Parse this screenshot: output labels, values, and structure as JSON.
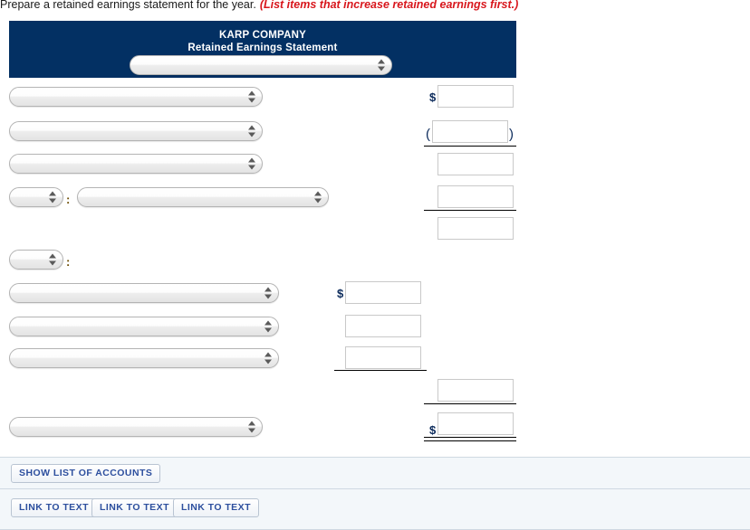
{
  "prompt": {
    "text": "Prepare a retained earnings statement for the year.",
    "hint": "(List items that increase retained earnings first.)"
  },
  "statement": {
    "company": "KARP COMPANY",
    "title": "Retained Earnings Statement",
    "period_select": {
      "value": "",
      "name": "statement-period-select"
    }
  },
  "colors": {
    "header_navy": "#033063",
    "hint_red": "#d8161c",
    "button_blue": "#2d4f9e",
    "footer_bg": "#f3f7fa"
  },
  "rows": [
    {
      "id": "row-1",
      "label_select": "",
      "amount": "",
      "prefix": "$",
      "suffix": ""
    },
    {
      "id": "row-2",
      "label_select": "",
      "amount": "",
      "prefix": "(",
      "suffix": ")"
    },
    {
      "id": "row-3",
      "label_select": "",
      "amount": "",
      "prefix": "",
      "suffix": ""
    },
    {
      "id": "row-4",
      "label_select_small": "",
      "label_select": "",
      "separator": ":",
      "amount": "",
      "prefix": "",
      "suffix": ""
    },
    {
      "id": "row-5-subtotal",
      "amount": "",
      "prefix": "",
      "suffix": ""
    },
    {
      "id": "row-6-heading",
      "label_select_small": "",
      "separator": ":"
    },
    {
      "id": "row-7",
      "label_select": "",
      "amount": "",
      "prefix": "$",
      "suffix": ""
    },
    {
      "id": "row-8",
      "label_select": "",
      "amount": "",
      "prefix": "",
      "suffix": ""
    },
    {
      "id": "row-9",
      "label_select": "",
      "amount": "",
      "prefix": "",
      "suffix": ""
    },
    {
      "id": "row-10-subtotal",
      "amount": "",
      "prefix": "",
      "suffix": ""
    },
    {
      "id": "row-11-total",
      "label_select": "",
      "amount": "",
      "prefix": "$",
      "suffix": ""
    }
  ],
  "footer": {
    "show_accounts_label": "SHOW LIST OF ACCOUNTS",
    "link_to_text_labels": [
      "LINK TO TEXT",
      "LINK TO TEXT",
      "LINK TO TEXT"
    ]
  }
}
